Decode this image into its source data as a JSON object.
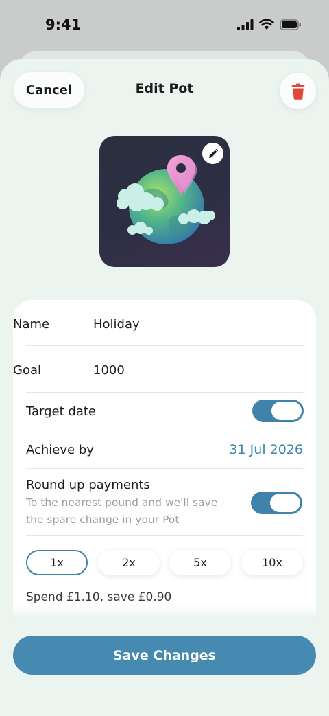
{
  "status_bar": {
    "time": "9:41"
  },
  "header": {
    "cancel_label": "Cancel",
    "title": "Edit Pot"
  },
  "pot": {
    "image_name": "globe-with-location-pin",
    "edit_icon": "pencil-icon"
  },
  "form": {
    "name_label": "Name",
    "name_value": "Holiday",
    "goal_label": "Goal",
    "goal_value": "1000",
    "target_date_label": "Target date",
    "target_date_enabled": true,
    "achieve_by_label": "Achieve by",
    "achieve_by_value": "31 Jul 2026",
    "round_up_label": "Round up payments",
    "round_up_desc_line1": "To the nearest pound and we'll save",
    "round_up_desc_line2": "the spare change in your Pot",
    "round_up_enabled": true,
    "multipliers": [
      "1x",
      "2x",
      "5x",
      "10x"
    ],
    "selected_multiplier": "1x",
    "example_text": "Spend £1.10, save £0.90"
  },
  "footer": {
    "save_label": "Save Changes"
  },
  "colors": {
    "accent": "#4689b1",
    "sheet_bg": "#ecf4ef",
    "delete": "#e0473a"
  }
}
